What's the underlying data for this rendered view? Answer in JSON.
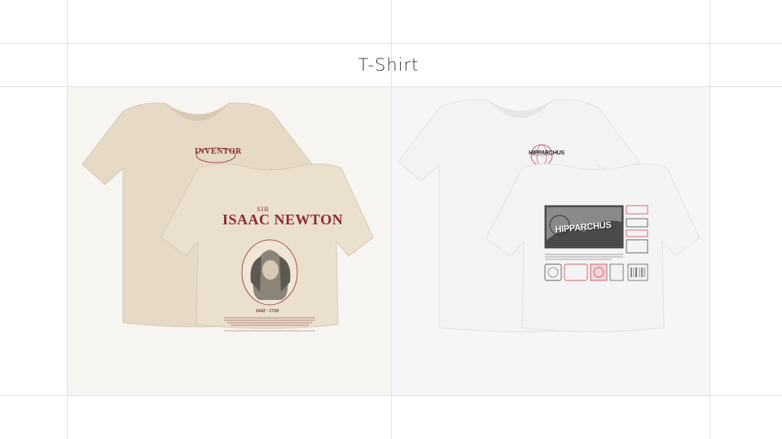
{
  "page": {
    "title": "T-Shirt"
  },
  "products": [
    {
      "front_print": "INVENTOR",
      "back_subtitle": "SIR",
      "back_title": "ISAAC NEWTON",
      "back_years": "1642 · 1726"
    },
    {
      "front_print": "HIPPARCHUS",
      "back_title": "HIPPARCHUS"
    }
  ],
  "colors": {
    "cream_shirt": "#e8dccb",
    "white_shirt": "#f2f2f2",
    "print_red": "#8a2b34"
  }
}
